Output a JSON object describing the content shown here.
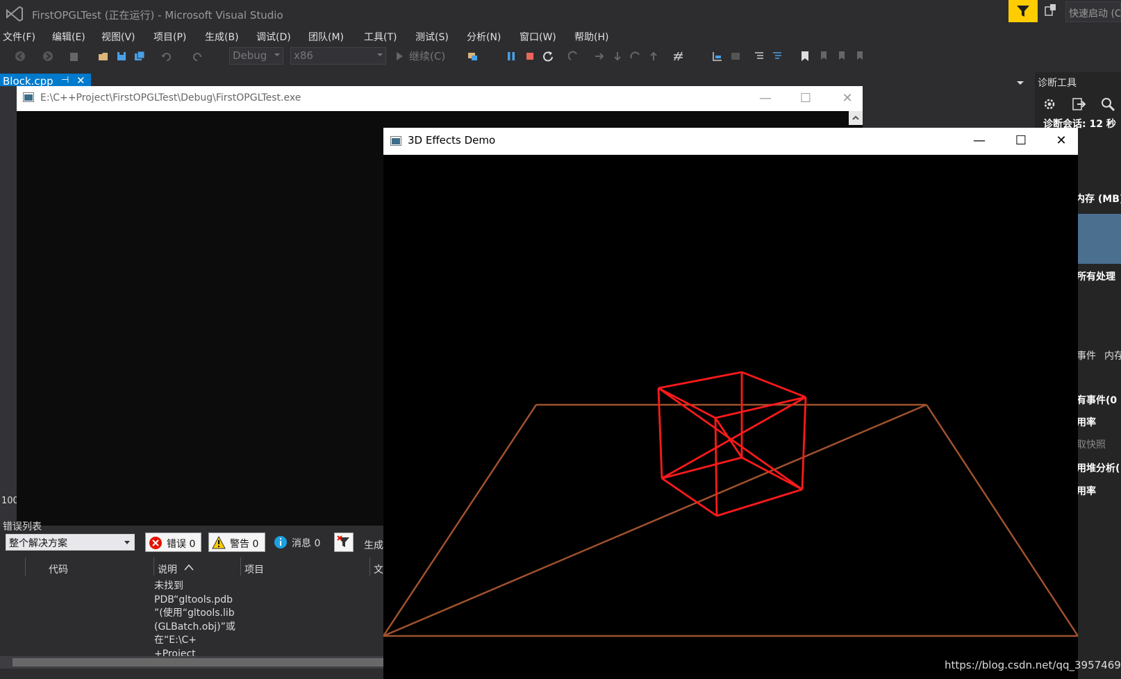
{
  "vs": {
    "title": "FirstOPGLTest (正在运行) - Microsoft Visual Studio",
    "quick_launch": "快速启动 (C",
    "menu": [
      "文件(F)",
      "编辑(E)",
      "视图(V)",
      "项目(P)",
      "生成(B)",
      "调试(D)",
      "团队(M)",
      "工具(T)",
      "测试(S)",
      "分析(N)",
      "窗口(W)",
      "帮助(H)"
    ],
    "toolbar": {
      "config": "Debug",
      "platform": "x86",
      "continue": "继续(C)"
    },
    "doc_tab": "Block.cpp",
    "zoom": "100"
  },
  "diagnostics": {
    "title": "诊断工具",
    "session": "诊断会话: 12 秒",
    "memory": "内存 (MB)",
    "all_processes": "所有处理",
    "events": "事件",
    "memory_short": "内存",
    "all_events": "有事件(0",
    "usage": "用率",
    "snapshot": "取快照",
    "heap": "用堆分析(",
    "usage2": "用率"
  },
  "console": {
    "title": "E:\\C++Project\\FirstOPGLTest\\Debug\\FirstOPGLTest.exe"
  },
  "error_list": {
    "title": "错误列表",
    "scope": "整个解决方案",
    "errors": "错误 0",
    "warnings": "警告 0",
    "messages": "消息 0",
    "build": "生成",
    "columns": [
      "代码",
      "说明",
      "项目",
      "文"
    ],
    "desc_lines": [
      "未找到",
      "PDB“gltools.pdb",
      "”(使用“gltools.lib",
      "(GLBatch.obj)”或",
      "在“E:\\C+",
      "+Project"
    ]
  },
  "gl": {
    "title": "3D Effects Demo",
    "floor_color": "#a0522d",
    "cube_color": "#ff1a1a"
  },
  "watermark": "https://blog.csdn.net/qq_39574690"
}
